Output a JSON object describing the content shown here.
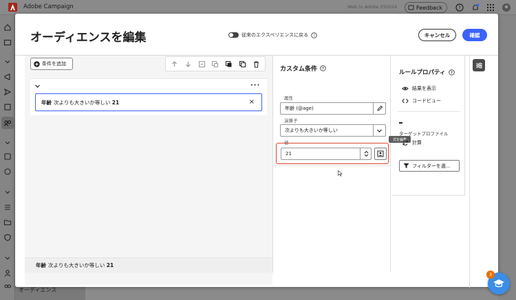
{
  "app": {
    "title": "Adobe Campaign",
    "org_name": "Web to Adobe 250024",
    "feedback_label": "Feedback",
    "notification_count": "3",
    "nav_audience_label": "オーディエンス"
  },
  "modal": {
    "title": "オーディエンスを編集",
    "legacy_toggle_label": "従来のエクスペリエンスに戻る",
    "cancel_label": "キャンセル",
    "confirm_label": "確認"
  },
  "canvas": {
    "add_condition_label": "条件を追加",
    "toolbar_tools": [
      "move-up-icon",
      "move-down-icon",
      "collapse-icon",
      "expand-icon",
      "duplicate-icon",
      "copy-icon",
      "delete-icon"
    ],
    "condition": {
      "attribute": "年齢",
      "operator": "次よりも大きいか等しい",
      "value": "21"
    },
    "summary": {
      "attribute": "年齢",
      "operator": "次よりも大きいか等しい",
      "value": "21"
    }
  },
  "custom_condition": {
    "title": "カスタム条件",
    "attribute_label": "属性",
    "attribute_value": "年齢 (@age)",
    "operator_label": "演算子",
    "operator_value": "次よりも大きいか等しい",
    "value_label": "値",
    "value": "21",
    "expression_tooltip": "式を編集"
  },
  "rule_properties": {
    "title": "ルールプロパティ",
    "view_results_label": "結果を表示",
    "code_view_label": "コードビュー",
    "target_profile_label": "ターゲットプロファイル",
    "calculate_label": "計算",
    "filter_button_label": "フィルターを選..."
  },
  "help": {
    "badge_count": "3"
  },
  "colors": {
    "accent": "#3b63fb",
    "highlight_border": "#d9452b",
    "brand": "#eb1000",
    "badge": "#e67000",
    "help_fab": "#3b8de6"
  }
}
